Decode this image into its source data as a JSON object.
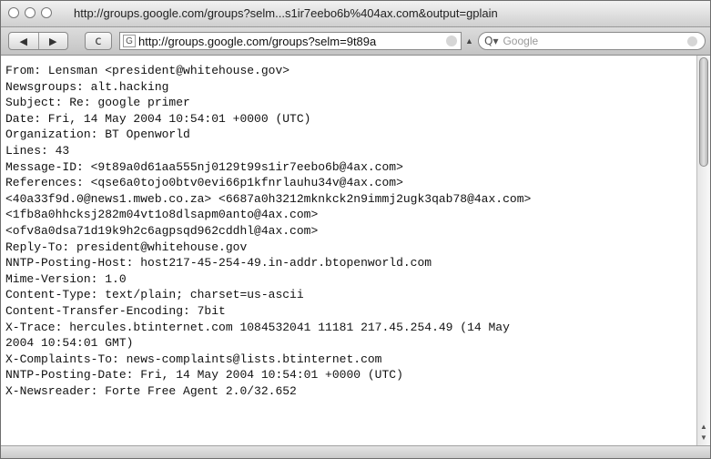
{
  "window": {
    "title": "http://groups.google.com/groups?selm...s1ir7eebo6b%404ax.com&output=gplain"
  },
  "toolbar": {
    "back_icon": "back-arrow-icon",
    "forward_icon": "forward-arrow-icon",
    "reload_label": "c",
    "address": "http://groups.google.com/groups?selm=9t89a",
    "search_placeholder": "Google"
  },
  "message": {
    "lines": [
      "From: Lensman <president@whitehouse.gov>",
      "Newsgroups: alt.hacking",
      "Subject: Re: google primer",
      "Date: Fri, 14 May 2004 10:54:01 +0000 (UTC)",
      "Organization: BT Openworld",
      "Lines: 43",
      "Message-ID: <9t89a0d61aa555nj0129t99s1ir7eebo6b@4ax.com>",
      "References: <qse6a0tojo0btv0evi66p1kfnrlauhu34v@4ax.com>",
      "<40a33f9d.0@news1.mweb.co.za> <6687a0h3212mknkck2n9immj2ugk3qab78@4ax.com>",
      "<1fb8a0hhcksj282m04vt1o8dlsapm0anto@4ax.com>",
      "<ofv8a0dsa71d19k9h2c6agpsqd962cddhl@4ax.com>",
      "Reply-To: president@whitehouse.gov",
      "NNTP-Posting-Host: host217-45-254-49.in-addr.btopenworld.com",
      "Mime-Version: 1.0",
      "Content-Type: text/plain; charset=us-ascii",
      "Content-Transfer-Encoding: 7bit",
      "X-Trace: hercules.btinternet.com 1084532041 11181 217.45.254.49 (14 May",
      "2004 10:54:01 GMT)",
      "X-Complaints-To: news-complaints@lists.btinternet.com",
      "NNTP-Posting-Date: Fri, 14 May 2004 10:54:01 +0000 (UTC)",
      "X-Newsreader: Forte Free Agent 2.0/32.652"
    ]
  }
}
